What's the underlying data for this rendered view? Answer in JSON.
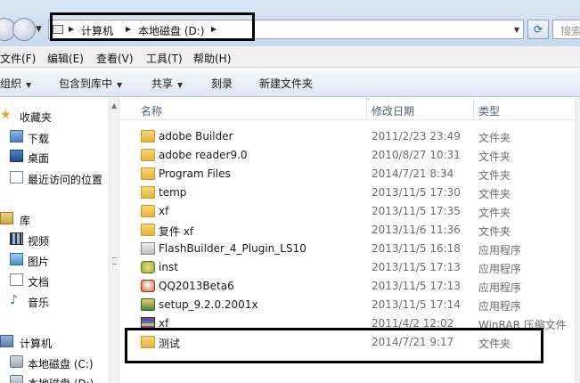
{
  "address": {
    "crumbs": [
      "计算机",
      "本地磁盘 (D:)"
    ],
    "search_placeholder": "搜索"
  },
  "menu": [
    "文件(F)",
    "编辑(E)",
    "查看(V)",
    "工具(T)",
    "帮助(H)"
  ],
  "toolbar": {
    "organize": "组织",
    "include_library": "包含到库中",
    "share": "共享",
    "burn": "刻录",
    "new_folder": "新建文件夹"
  },
  "sidebar": {
    "favorites": "收藏夹",
    "downloads": "下载",
    "desktop": "桌面",
    "recent": "最近访问的位置",
    "libraries": "库",
    "videos": "视频",
    "pictures": "图片",
    "documents": "文档",
    "music": "音乐",
    "computer": "计算机",
    "drive_c": "本地磁盘 (C:)",
    "drive_d": "本地磁盘 (D:)"
  },
  "columns": {
    "name": "名称",
    "date": "修改日期",
    "type": "类型"
  },
  "files": [
    {
      "name": "adobe Builder",
      "date": "2011/2/23 23:49",
      "type": "文件夹",
      "icon": "folder-icon"
    },
    {
      "name": "adobe reader9.0",
      "date": "2010/8/27 10:31",
      "type": "文件夹",
      "icon": "folder-icon"
    },
    {
      "name": "Program Files",
      "date": "2014/7/21 8:34",
      "type": "文件夹",
      "icon": "folder-icon"
    },
    {
      "name": "temp",
      "date": "2013/11/5 17:30",
      "type": "文件夹",
      "icon": "folder-icon"
    },
    {
      "name": "xf",
      "date": "2013/11/5 17:35",
      "type": "文件夹",
      "icon": "folder-icon"
    },
    {
      "name": "复件 xf",
      "date": "2013/11/6 11:36",
      "type": "文件夹",
      "icon": "folder-icon"
    },
    {
      "name": "FlashBuilder_4_Plugin_LS10",
      "date": "2013/11/5 16:18",
      "type": "应用程序",
      "icon": "flashbuilder-app-icon"
    },
    {
      "name": "inst",
      "date": "2013/11/5 17:13",
      "type": "应用程序",
      "icon": "installer-app-icon"
    },
    {
      "name": "QQ2013Beta6",
      "date": "2013/11/5 17:13",
      "type": "应用程序",
      "icon": "qq-app-icon"
    },
    {
      "name": "setup_9.2.0.2001x",
      "date": "2013/11/5 17:14",
      "type": "应用程序",
      "icon": "setup-app-icon"
    },
    {
      "name": "xf",
      "date": "2011/4/2 12:02",
      "type": "WinRAR 压缩文件",
      "icon": "winrar-archive-icon"
    },
    {
      "name": "测试",
      "date": "2014/7/21 9:17",
      "type": "文件夹",
      "icon": "folder-icon"
    }
  ]
}
